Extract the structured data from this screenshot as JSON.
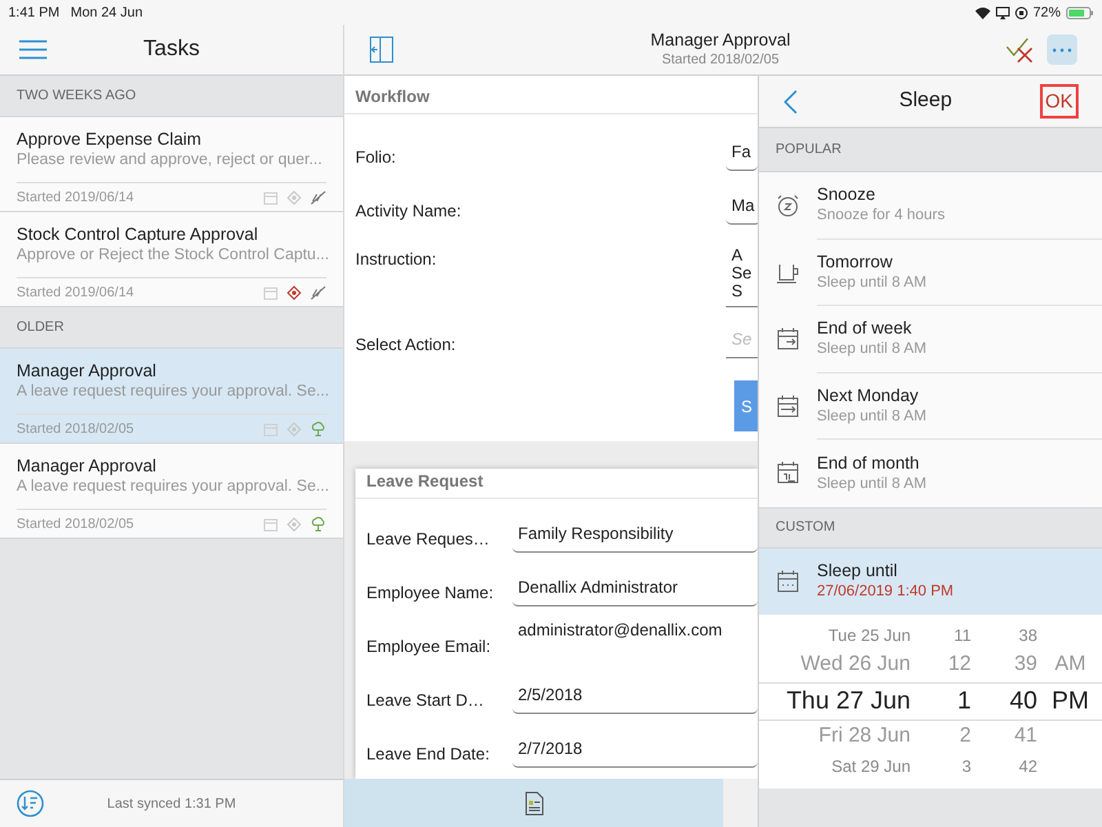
{
  "status_bar": {
    "time": "1:41 PM",
    "date": "Mon 24 Jun",
    "battery": "72%"
  },
  "tasks_pane": {
    "title": "Tasks",
    "sections": [
      {
        "heading": "TWO WEEKS AGO",
        "items": [
          {
            "title": "Approve Expense Claim",
            "description": "Please review and approve, reject or quer...",
            "started": "Started 2019/06/14",
            "selected": false,
            "flagged": false,
            "kind": "unlinked"
          },
          {
            "title": "Stock Control Capture Approval",
            "description": "Approve or Reject the Stock Control Captu...",
            "started": "Started 2019/06/14",
            "selected": false,
            "flagged": true,
            "kind": "unlinked"
          }
        ]
      },
      {
        "heading": "OLDER",
        "items": [
          {
            "title": "Manager Approval",
            "description": "A leave request requires your approval. Se...",
            "started": "Started 2018/02/05",
            "selected": true,
            "flagged": false,
            "kind": "cloud"
          },
          {
            "title": "Manager Approval",
            "description": "A leave request requires your approval. Se...",
            "started": "Started 2018/02/05",
            "selected": false,
            "flagged": false,
            "kind": "cloud"
          }
        ]
      }
    ],
    "footer": "Last synced 1:31 PM"
  },
  "detail": {
    "title": "Manager Approval",
    "subtitle": "Started 2018/02/05",
    "workflow": {
      "heading": "Workflow",
      "fields": [
        {
          "label": "Folio:",
          "kind": "input",
          "value": "Fa"
        },
        {
          "label": "Activity Name:",
          "kind": "input",
          "value": "Ma"
        },
        {
          "label": "Instruction:",
          "kind": "multiline",
          "lines": [
            "A",
            "Se",
            "S"
          ]
        },
        {
          "label": "Select Action:",
          "kind": "select",
          "placeholder": "Se"
        }
      ],
      "button": "S"
    },
    "leave_request": {
      "heading": "Leave Request",
      "fields": [
        {
          "label": "Leave Reques…",
          "kind": "input",
          "value": "Family Responsibility"
        },
        {
          "label": "Employee Name:",
          "kind": "input",
          "value": "Denallix Administrator"
        },
        {
          "label": "Employee Email:",
          "kind": "text",
          "value": "administrator@denallix.com"
        },
        {
          "label": "Leave Start D…",
          "kind": "input",
          "value": "2/5/2018"
        },
        {
          "label": "Leave End Date:",
          "kind": "input",
          "value": "2/7/2018"
        }
      ]
    }
  },
  "sleep_panel": {
    "title": "Sleep",
    "ok": "OK",
    "ok_highlighted": true,
    "popular_heading": "POPULAR",
    "options": [
      {
        "kind": "alarm",
        "title": "Snooze",
        "subtitle": "Snooze for 4 hours"
      },
      {
        "kind": "cup",
        "title": "Tomorrow",
        "subtitle": "Sleep until 8 AM"
      },
      {
        "kind": "week",
        "title": "End of week",
        "subtitle": "Sleep until 8 AM"
      },
      {
        "kind": "next",
        "title": "Next Monday",
        "subtitle": "Sleep until 8 AM"
      },
      {
        "kind": "month",
        "title": "End of month",
        "subtitle": "Sleep until 8 AM"
      }
    ],
    "custom_heading": "CUSTOM",
    "custom": {
      "title": "Sleep until",
      "value": "27/06/2019 1:40 PM",
      "selected": true
    },
    "picker_rows": [
      {
        "cells": [
          "Tue 25 Jun",
          "11",
          "38"
        ],
        "selected": false
      },
      {
        "cells": [
          "Wed 26 Jun",
          "12",
          "39",
          "AM"
        ],
        "selected": false
      },
      {
        "cells": [
          "Thu 27 Jun",
          "1",
          "40",
          "PM"
        ],
        "selected": true
      },
      {
        "cells": [
          "Fri 28 Jun",
          "2",
          "41"
        ],
        "selected": false
      },
      {
        "cells": [
          "Sat 29 Jun",
          "3",
          "42"
        ],
        "selected": false
      }
    ]
  }
}
